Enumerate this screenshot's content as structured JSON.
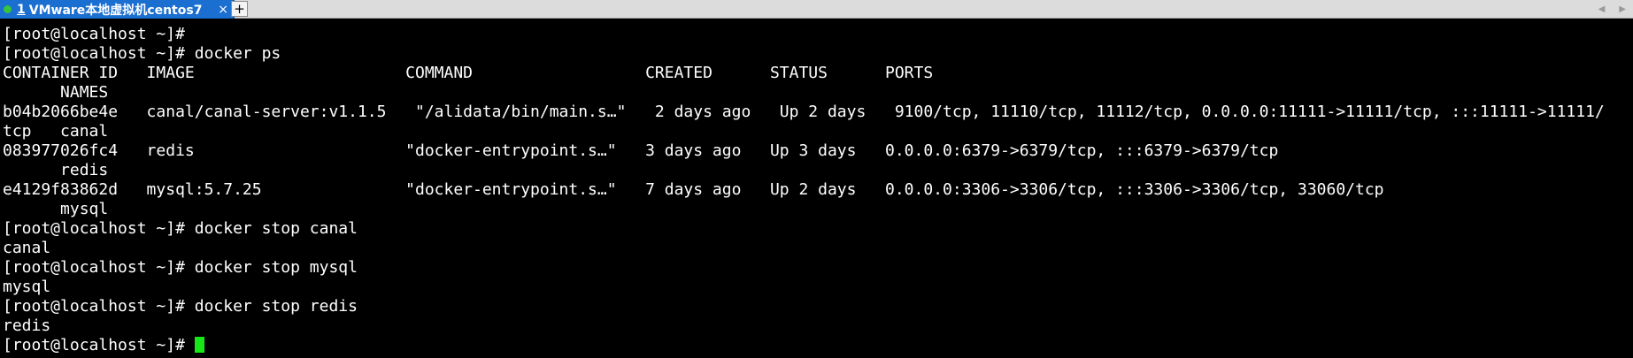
{
  "tabbar": {
    "tab_number": "1",
    "tab_title": "VMware本地虚拟机centos7",
    "close_glyph": "×",
    "new_tab_glyph": "+",
    "scroll_left_glyph": "◀",
    "scroll_right_glyph": "▶",
    "active_tab_color": "#1a6fd1",
    "status_dot_color": "#35c43a"
  },
  "terminal": {
    "prompt": "[root@localhost ~]# ",
    "cursor_color": "#19e619",
    "lines": [
      "[root@localhost ~]# ",
      "[root@localhost ~]# docker ps",
      "CONTAINER ID   IMAGE                      COMMAND                  CREATED      STATUS      PORTS",
      "      NAMES",
      "b04b2066be4e   canal/canal-server:v1.1.5   \"/alidata/bin/main.s…\"   2 days ago   Up 2 days   9100/tcp, 11110/tcp, 11112/tcp, 0.0.0.0:11111->11111/tcp, :::11111->11111/",
      "tcp   canal",
      "083977026fc4   redis                      \"docker-entrypoint.s…\"   3 days ago   Up 3 days   0.0.0.0:6379->6379/tcp, :::6379->6379/tcp",
      "      redis",
      "e4129f83862d   mysql:5.7.25               \"docker-entrypoint.s…\"   7 days ago   Up 2 days   0.0.0.0:3306->3306/tcp, :::3306->3306/tcp, 33060/tcp",
      "      mysql",
      "[root@localhost ~]# docker stop canal",
      "canal",
      "[root@localhost ~]# docker stop mysql",
      "mysql",
      "[root@localhost ~]# docker stop redis",
      "redis"
    ]
  }
}
